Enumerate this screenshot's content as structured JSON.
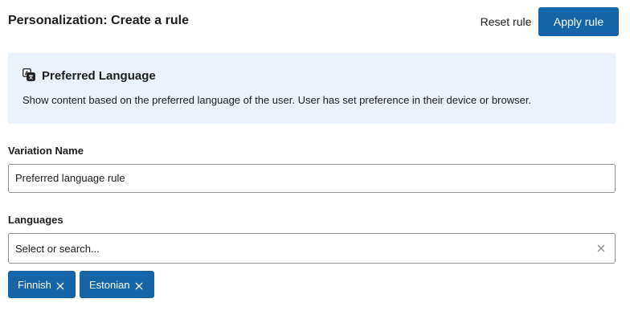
{
  "header": {
    "title": "Personalization: Create a rule",
    "reset_label": "Reset rule",
    "apply_label": "Apply rule"
  },
  "info": {
    "icon": "translate-icon",
    "title": "Preferred Language",
    "description": "Show content based on the preferred language of the user. User has set preference in their device or browser."
  },
  "variation": {
    "label": "Variation Name",
    "value": "Preferred language rule"
  },
  "languages": {
    "label": "Languages",
    "placeholder": "Select or search...",
    "selected": [
      "Finnish",
      "Estonian"
    ]
  },
  "colors": {
    "accent": "#1565a8",
    "info_bg": "#ebf2fb"
  }
}
